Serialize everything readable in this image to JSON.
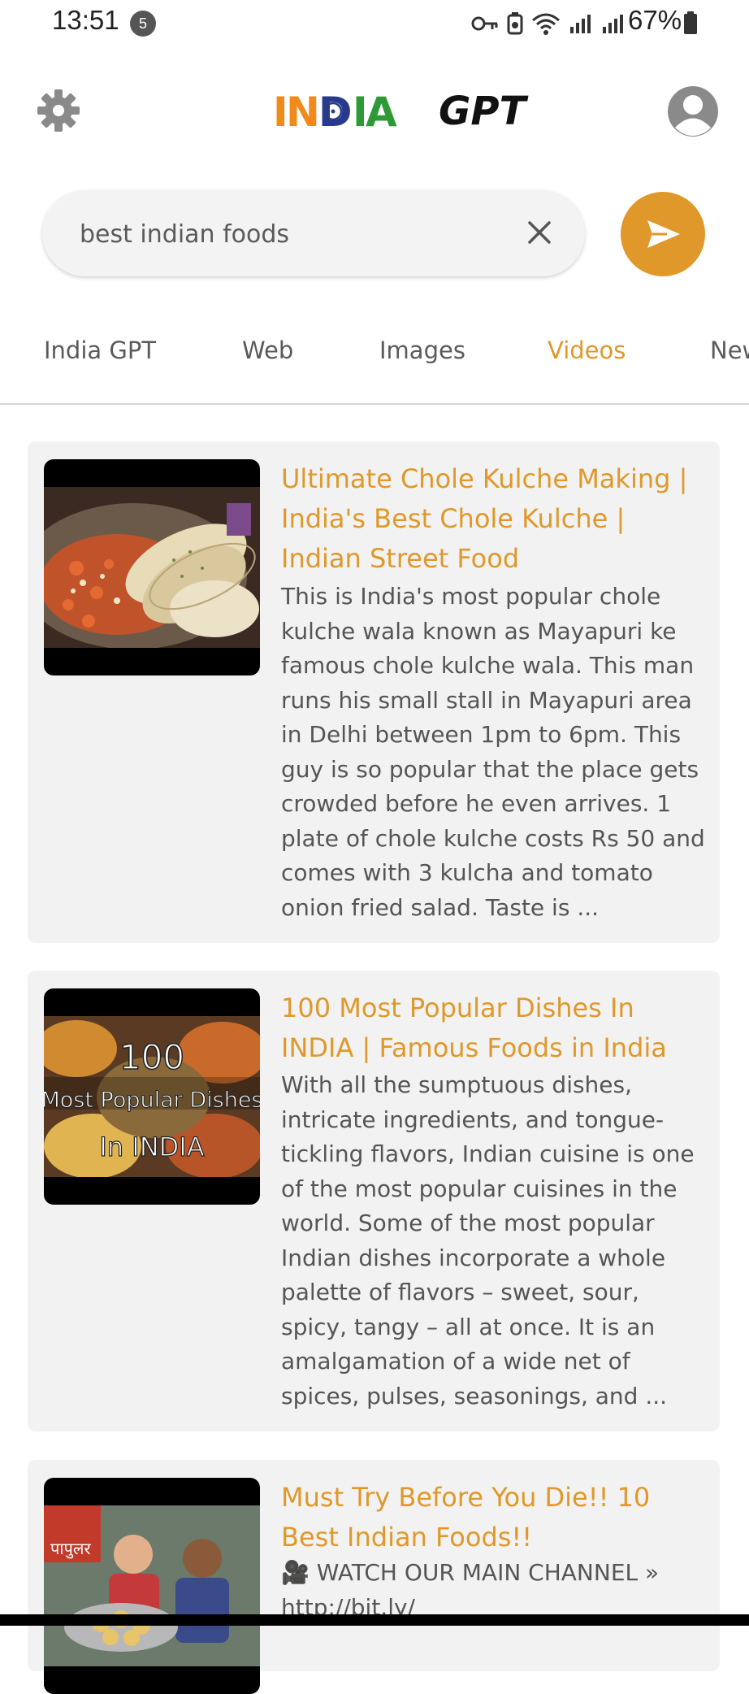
{
  "status_bar": {
    "time": "13:51",
    "notification_count": "5",
    "battery": "67%"
  },
  "header": {
    "logo_india": "INDIA",
    "logo_gpt": "GPT"
  },
  "search": {
    "query": "best indian foods"
  },
  "tabs": [
    {
      "label": "India GPT",
      "active": false
    },
    {
      "label": "Web",
      "active": false
    },
    {
      "label": "Images",
      "active": false
    },
    {
      "label": "Videos",
      "active": true
    },
    {
      "label": "News",
      "active": false
    }
  ],
  "results": [
    {
      "title": "Ultimate Chole Kulche Making | India's Best Chole Kulche | Indian Street Food",
      "description": "This is India's most popular chole kulche wala known as Mayapuri ke famous chole kulche wala. This man runs his small stall in Mayapuri area in Delhi between 1pm to 6pm. This guy is so popular that the place gets crowded before he even arrives. 1 plate of chole kulche costs Rs 50 and comes with 3 kulcha and tomato onion fried salad. Taste is ..."
    },
    {
      "title": "100 Most Popular Dishes In INDIA | Famous Foods in India",
      "description": "With all the sumptuous dishes, intricate ingredients, and tongue-tickling flavors, Indian cuisine is one of the most popular cuisines in the world. Some of the most popular Indian dishes incorporate a whole palette of flavors – sweet, sour, spicy, tangy – all at once. It is an amalgamation of a wide net of spices, pulses, seasonings, and ...",
      "thumb_text": [
        "100",
        "Most Popular Dishes",
        "In INDIA"
      ]
    },
    {
      "title": "Must Try Before You Die!! 10 Best Indian Foods!!",
      "description": "🎥 WATCH OUR MAIN CHANNEL » http://bit.ly/",
      "thumb_text": [
        "पापुलर"
      ]
    }
  ],
  "colors": {
    "accent": "#e0982a",
    "card_bg": "#f2f2f2"
  }
}
